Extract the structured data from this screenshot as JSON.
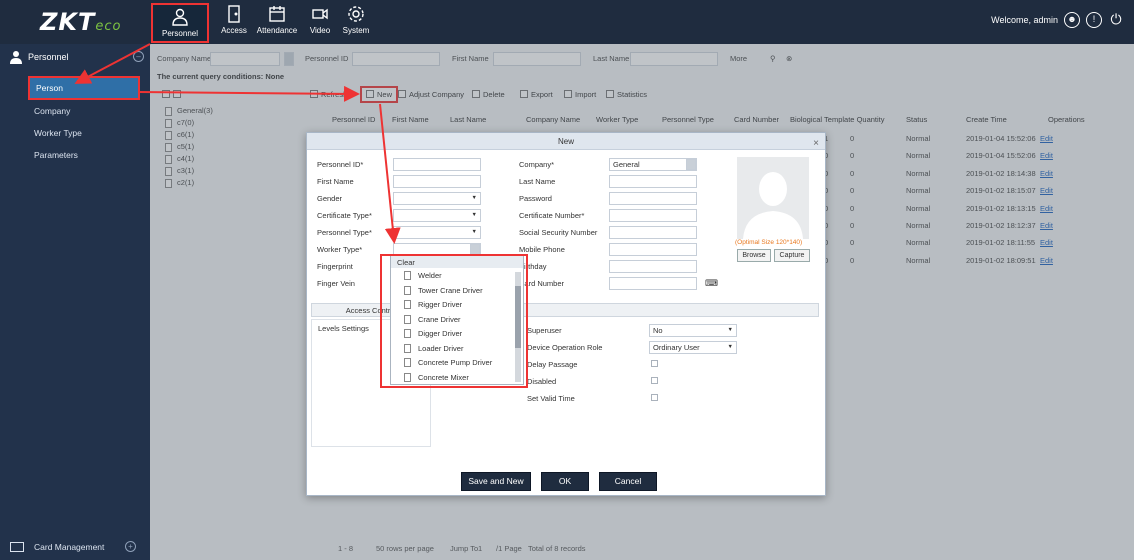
{
  "brand": {
    "logo": "ZKT",
    "logo_suffix": "eco"
  },
  "nav": [
    {
      "label": "Personnel",
      "icon": "person-badge-icon"
    },
    {
      "label": "Access",
      "icon": "door-icon"
    },
    {
      "label": "Attendance",
      "icon": "calendar-icon"
    },
    {
      "label": "Video",
      "icon": "camera-icon"
    },
    {
      "label": "System",
      "icon": "gear-icon"
    }
  ],
  "welcome": "Welcome, admin",
  "sidebar": {
    "header": "Personnel",
    "items": [
      {
        "label": "Person",
        "active": true
      },
      {
        "label": "Company"
      },
      {
        "label": "Worker Type"
      },
      {
        "label": "Parameters"
      }
    ],
    "bottom": "Card Management"
  },
  "query": {
    "company_label": "Company Name",
    "personnel_id_label": "Personnel ID",
    "first_name_label": "First Name",
    "last_name_label": "Last Name",
    "more_label": "More",
    "conditions": "The current query conditions: None"
  },
  "toolbar": {
    "refresh": "Refresh",
    "new": "New",
    "adjust_company": "Adjust Company",
    "delete": "Delete",
    "export": "Export",
    "import": "Import",
    "statistics": "Statistics"
  },
  "tree": [
    "General(3)",
    "c7(0)",
    "c6(1)",
    "c5(1)",
    "c4(1)",
    "c3(1)",
    "c2(1)"
  ],
  "grid": {
    "headers": [
      "Personnel ID",
      "First Name",
      "Last Name",
      "Company Name",
      "Worker Type",
      "Personnel Type",
      "Card Number",
      "Biological Template Quantity",
      "Status",
      "Create Time",
      "Operations"
    ],
    "rows": [
      {
        "bio_a": "1",
        "bio_b": "0",
        "status": "Normal",
        "time": "2019-01-04 15:52:06",
        "op": "Edit"
      },
      {
        "bio_a": "0",
        "bio_b": "0",
        "status": "Normal",
        "time": "2019-01-04 15:52:06",
        "op": "Edit"
      },
      {
        "bio_a": "0",
        "bio_b": "0",
        "status": "Normal",
        "time": "2019-01-02 18:14:38",
        "op": "Edit"
      },
      {
        "bio_a": "0",
        "bio_b": "0",
        "status": "Normal",
        "time": "2019-01-02 18:15:07",
        "op": "Edit"
      },
      {
        "bio_a": "0",
        "bio_b": "0",
        "status": "Normal",
        "time": "2019-01-02 18:13:15",
        "op": "Edit"
      },
      {
        "bio_a": "0",
        "bio_b": "0",
        "status": "Normal",
        "time": "2019-01-02 18:12:37",
        "op": "Edit"
      },
      {
        "bio_a": "0",
        "bio_b": "0",
        "status": "Normal",
        "time": "2019-01-02 18:11:55",
        "op": "Edit"
      },
      {
        "bio_a": "0",
        "bio_b": "0",
        "status": "Normal",
        "time": "2019-01-02 18:09:51",
        "op": "Edit"
      }
    ]
  },
  "pager": {
    "range": "1 - 8",
    "rows_per_page": "50 rows per page",
    "jump_to": "Jump To",
    "page_value": "1",
    "pages": "/1 Page",
    "total": "Total of 8 records"
  },
  "modal": {
    "title": "New",
    "fields": {
      "personnel_id": "Personnel ID*",
      "first_name": "First Name",
      "gender": "Gender",
      "certificate_type": "Certificate Type*",
      "personnel_type": "Personnel Type*",
      "worker_type": "Worker Type*",
      "fingerprint": "Fingerprint",
      "finger_vein": "Finger Vein",
      "company": "Company*",
      "company_value": "General",
      "last_name": "Last Name",
      "password": "Password",
      "certificate_number": "Certificate Number*",
      "ssn": "Social Security Number",
      "mobile": "Mobile Phone",
      "birthday": "Birthday",
      "card_number": "Card Number"
    },
    "photo_note": "(Optimal Size 120*140)",
    "browse": "Browse",
    "capture": "Capture",
    "tabs": [
      "Access Control",
      "Personnel Detail"
    ],
    "levels_settings": "Levels Settings",
    "detail": {
      "superuser": "Superuser",
      "superuser_value": "No",
      "device_role": "Device Operation Role",
      "device_role_value": "Ordinary User",
      "delay_passage": "Delay Passage",
      "disabled": "Disabled",
      "set_valid_time": "Set Valid Time"
    },
    "buttons": {
      "save_new": "Save and New",
      "ok": "OK",
      "cancel": "Cancel"
    }
  },
  "dropdown": {
    "clear": "Clear",
    "items": [
      "Welder",
      "Tower Crane Driver",
      "Rigger Driver",
      "Crane Driver",
      "Digger Driver",
      "Loader Driver",
      "Concrete Pump Driver",
      "Concrete Mixer"
    ]
  },
  "colors": {
    "topbar": "#1f2c3f",
    "sidebar": "#22324b",
    "active": "#2f6fa7",
    "annotation": "#e33333"
  }
}
